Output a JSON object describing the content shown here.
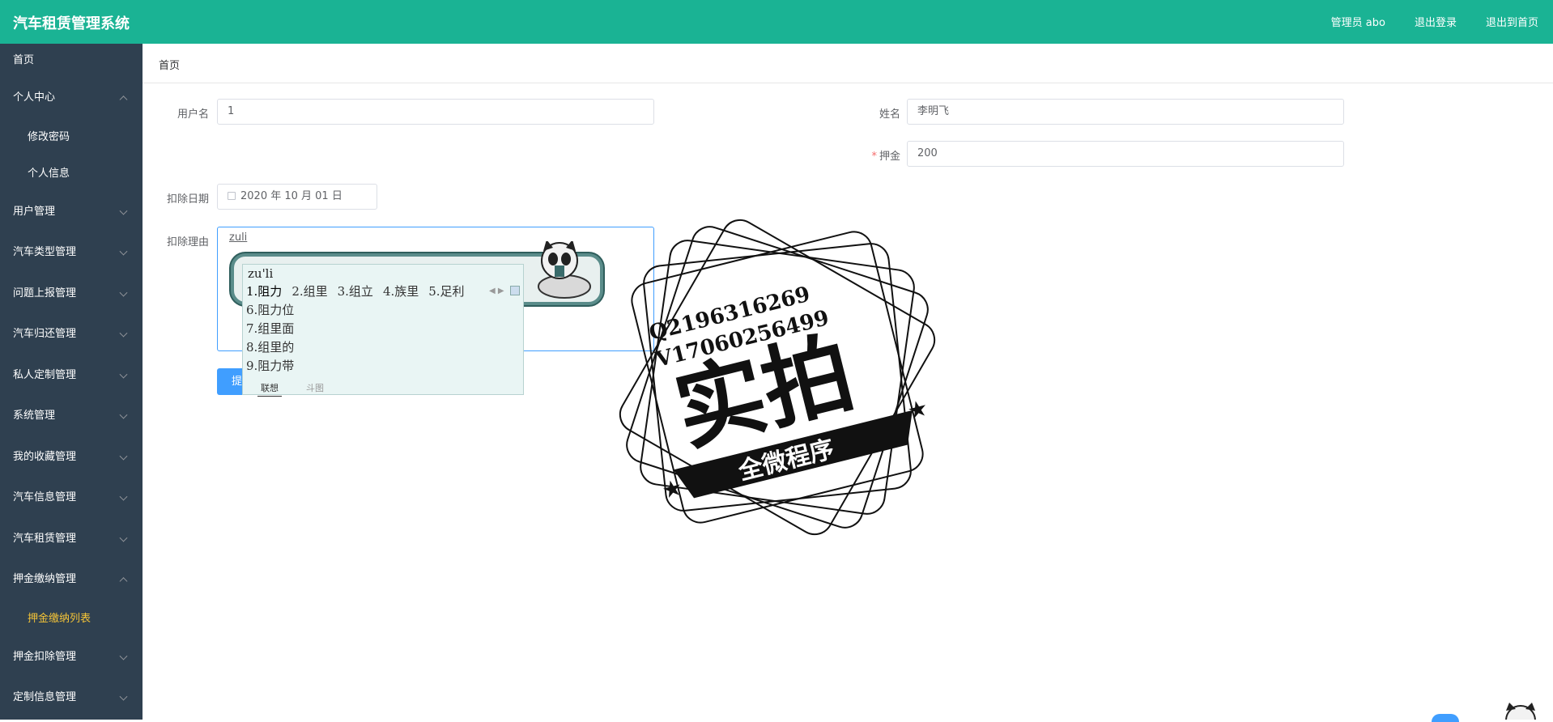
{
  "header": {
    "app_title": "汽车租赁管理系统",
    "admin_label": "管理员 abo",
    "logout": "退出登录",
    "back_home": "退出到首页"
  },
  "sidebar": {
    "home": "首页",
    "personal_center": "个人中心",
    "change_password": "修改密码",
    "personal_info": "个人信息",
    "items": [
      "用户管理",
      "汽车类型管理",
      "问题上报管理",
      "汽车归还管理",
      "私人定制管理",
      "系统管理",
      "我的收藏管理",
      "汽车信息管理",
      "汽车租赁管理"
    ],
    "deposit_payment": "押金缴纳管理",
    "deposit_payment_list": "押金缴纳列表",
    "deposit_deduction": "押金扣除管理",
    "custom_info": "定制信息管理"
  },
  "breadcrumb": "首页",
  "form": {
    "username_label": "用户名",
    "username_value": "1",
    "name_label": "姓名",
    "name_value": "李明飞",
    "deposit_label": "押金",
    "deposit_value": "200",
    "date_label": "扣除日期",
    "date_value": "2020 年 10 月 01 日",
    "reason_label": "扣除理由",
    "reason_value": "zuli",
    "submit_label": "提"
  },
  "ime": {
    "pinyin": "zu'li",
    "row": [
      "1.阻力",
      "2.组里",
      "3.组立",
      "4.族里",
      "5.足利"
    ],
    "list": [
      "6.阻力位",
      "7.组里面",
      "8.组里的",
      "9.阻力带"
    ],
    "tab_active": "联想",
    "tab_other": "斗图"
  },
  "watermark": {
    "line1": "Q2196316269",
    "line2": "V17060256499",
    "big": "实拍",
    "ribbon": "全微程序"
  }
}
